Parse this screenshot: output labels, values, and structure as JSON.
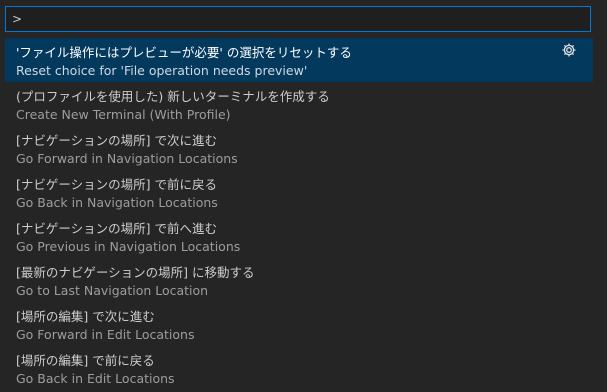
{
  "input": {
    "value": ">"
  },
  "items": [
    {
      "label": "'ファイル操作にはプレビューが必要' の選択をリセットする",
      "detail": "Reset choice for 'File operation needs preview'",
      "selected": true,
      "icon": "gear-icon"
    },
    {
      "label": "(プロファイルを使用した) 新しいターミナルを作成する",
      "detail": "Create New Terminal (With Profile)"
    },
    {
      "label": "[ナビゲーションの場所] で次に進む",
      "detail": "Go Forward in Navigation Locations"
    },
    {
      "label": "[ナビゲーションの場所] で前に戻る",
      "detail": "Go Back in Navigation Locations"
    },
    {
      "label": "[ナビゲーションの場所] で前へ進む",
      "detail": "Go Previous in Navigation Locations"
    },
    {
      "label": "[最新のナビゲーションの場所] に移動する",
      "detail": "Go to Last Navigation Location"
    },
    {
      "label": "[場所の編集] で次に進む",
      "detail": "Go Forward in Edit Locations"
    },
    {
      "label": "[場所の編集] で前に戻る",
      "detail": "Go Back in Edit Locations"
    }
  ],
  "colors": {
    "accent": "#0078d4",
    "selected_bg": "#04395e",
    "background": "#252526"
  }
}
